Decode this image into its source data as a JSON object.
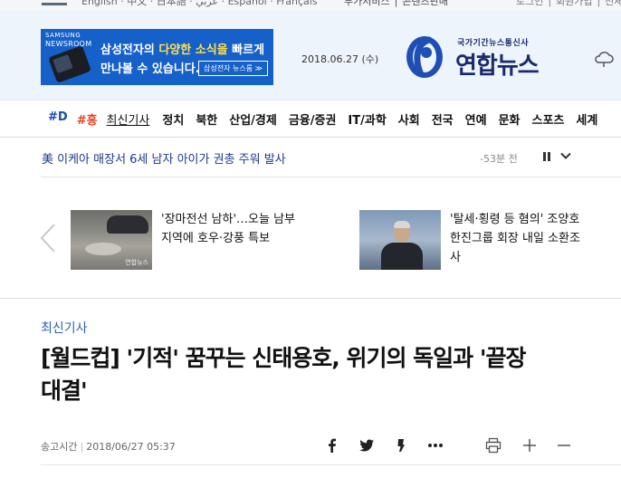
{
  "util_bar": {
    "languages": "English · 中文 · 日本語 · عربي · Español · Français",
    "links_center": "부가서비스 │ 콘텐츠판매",
    "links_right": "로그인 │ 회원가입 │ 전체"
  },
  "ad": {
    "brand_top": "SAMSUNG",
    "brand_bottom": "NEWSROOM",
    "line1_pre": "삼성전자의 ",
    "line1_hl": "다양한 소식을",
    "line1_post": " 빠르게",
    "line2": "만나볼 수 있습니다.",
    "button": "삼성전자 뉴스룸 ≫"
  },
  "header": {
    "date": "2018.06.27 (수)",
    "logo_sub": "국가기간뉴스통신사",
    "logo_name": "연합뉴스"
  },
  "nav": {
    "items": [
      "#D",
      "#흥",
      "최신기사",
      "정치",
      "북한",
      "산업/경제",
      "금융/증권",
      "IT/과학",
      "사회",
      "전국",
      "연예",
      "문화",
      "스포츠",
      "세계"
    ]
  },
  "ticker": {
    "text": "美 이케아 매장서 6세 남자 아이가 권총 주워 발사",
    "time": "-53분 전"
  },
  "carousel": {
    "cards": [
      {
        "line1": "'장마전선 남하'…오늘 남부",
        "line2": "지역에 호우·강풍 특보",
        "line3": "",
        "thumb_mark": "연합뉴스"
      },
      {
        "line1": "'탈세·횡령 등 혐의' 조양호",
        "line2": "한진그룹 회장 내일 소환조",
        "line3": "사"
      }
    ]
  },
  "article": {
    "section": "최신기사",
    "headline_line1": "[월드컵] '기적' 꿈꾸는 신태용호, 위기의 독일과 '끝장",
    "headline_line2": "대결'",
    "meta_label": "송고시간",
    "meta_time": "2018/06/27 05:37"
  },
  "colors": {
    "brand_navy": "#1a2a6c",
    "link_blue": "#2a62b8",
    "accent_red": "#e8421c",
    "ad_blue": "#1660c9"
  },
  "icons": [
    "weather-cloud-icon",
    "pause-icon",
    "chevron-down-icon",
    "chevron-left-icon",
    "facebook-icon",
    "twitter-icon",
    "kakao-story-icon",
    "more-icon",
    "print-icon",
    "font-plus-icon",
    "font-minus-icon"
  ]
}
